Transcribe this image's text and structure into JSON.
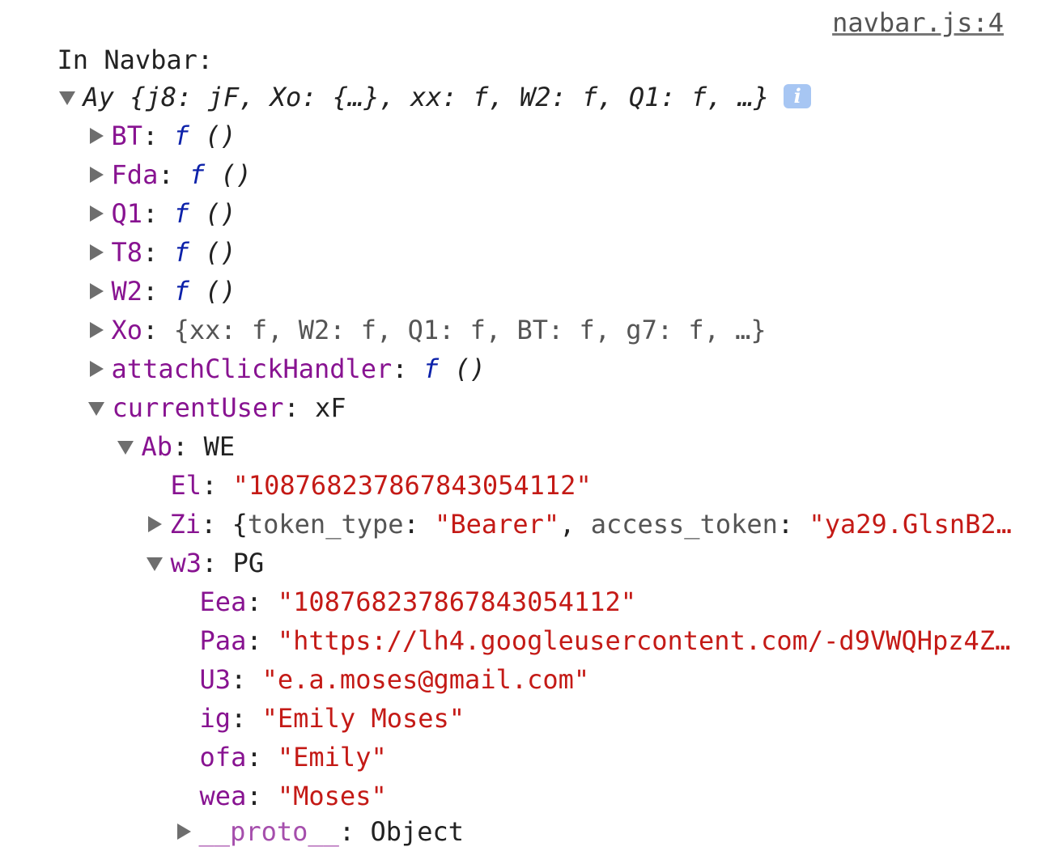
{
  "console": {
    "log_label": "In Navbar:",
    "source_link": "navbar.js:4",
    "info_icon": "info-icon",
    "root_summary": {
      "name": "Ay",
      "preview": " {j8: jF, Xo: {…}, xx: f, W2: f, Q1: f, …}"
    },
    "props": {
      "BT": {
        "key": "BT",
        "value": "f",
        "args": " ()"
      },
      "Fda": {
        "key": "Fda",
        "value": "f",
        "args": " ()"
      },
      "Q1": {
        "key": "Q1",
        "value": "f",
        "args": " ()"
      },
      "T8": {
        "key": "T8",
        "value": "f",
        "args": " ()"
      },
      "W2": {
        "key": "W2",
        "value": "f",
        "args": " ()"
      },
      "Xo": {
        "key": "Xo",
        "value": "{xx: f, W2: f, Q1: f, BT: f, g7: f, …}"
      },
      "attach": {
        "key": "attachClickHandler",
        "value": "f",
        "args": " ()"
      },
      "currentUser": {
        "key": "currentUser",
        "value": "xF"
      },
      "Ab": {
        "key": "Ab",
        "value": "WE"
      },
      "El": {
        "key": "El",
        "value": "\"108768237867843054112\""
      },
      "Zi": {
        "key": "Zi",
        "open": "{",
        "k1": "token_type",
        "v1": "\"Bearer\"",
        "k2": "access_token",
        "v2": "\"ya29.GlsnB2…"
      },
      "w3": {
        "key": "w3",
        "value": "PG"
      },
      "Eea": {
        "key": "Eea",
        "value": "\"108768237867843054112\""
      },
      "Paa": {
        "key": "Paa",
        "value": "\"https://lh4.googleusercontent.com/-d9VWQHpz4Z…"
      },
      "U3": {
        "key": "U3",
        "value": "\"e.a.moses@gmail.com\""
      },
      "ig": {
        "key": "ig",
        "value": "\"Emily Moses\""
      },
      "ofa": {
        "key": "ofa",
        "value": "\"Emily\""
      },
      "wea": {
        "key": "wea",
        "value": "\"Moses\""
      },
      "proto": {
        "key": "__proto__",
        "value": "Object"
      }
    }
  },
  "colors": {
    "key": "#881391",
    "string": "#c41a16",
    "function": "#0d22aa",
    "text": "#222222"
  }
}
